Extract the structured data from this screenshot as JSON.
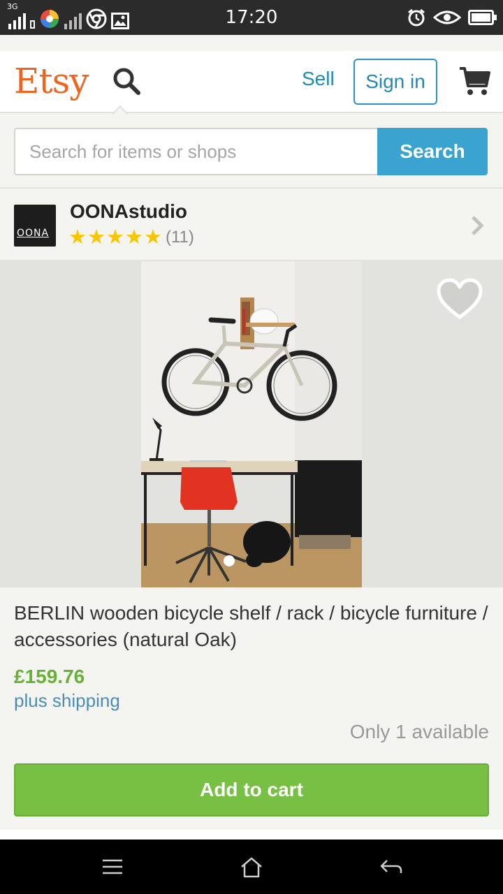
{
  "status_bar": {
    "time": "17:20",
    "network": "3G"
  },
  "header": {
    "logo": "Etsy",
    "sell_label": "Sell",
    "signin_label": "Sign in"
  },
  "search": {
    "placeholder": "Search for items or shops",
    "button_label": "Search"
  },
  "shop": {
    "name": "OONAstudio",
    "avatar_text": "OONA",
    "rating_stars": 5,
    "review_count": "(11)"
  },
  "listing": {
    "title": "BERLIN wooden bicycle shelf / rack / bicycle furniture / accessories (natural Oak)",
    "price": "£159.76",
    "shipping": "plus shipping",
    "availability": "Only 1 available",
    "add_to_cart_label": "Add to cart",
    "image_count_active": 1
  },
  "colors": {
    "brand": "#f1641e",
    "link": "#1f8ab6",
    "search_button": "#3aa3cf",
    "price": "#67b135",
    "add_to_cart": "#77c043",
    "star": "#f7c600"
  }
}
